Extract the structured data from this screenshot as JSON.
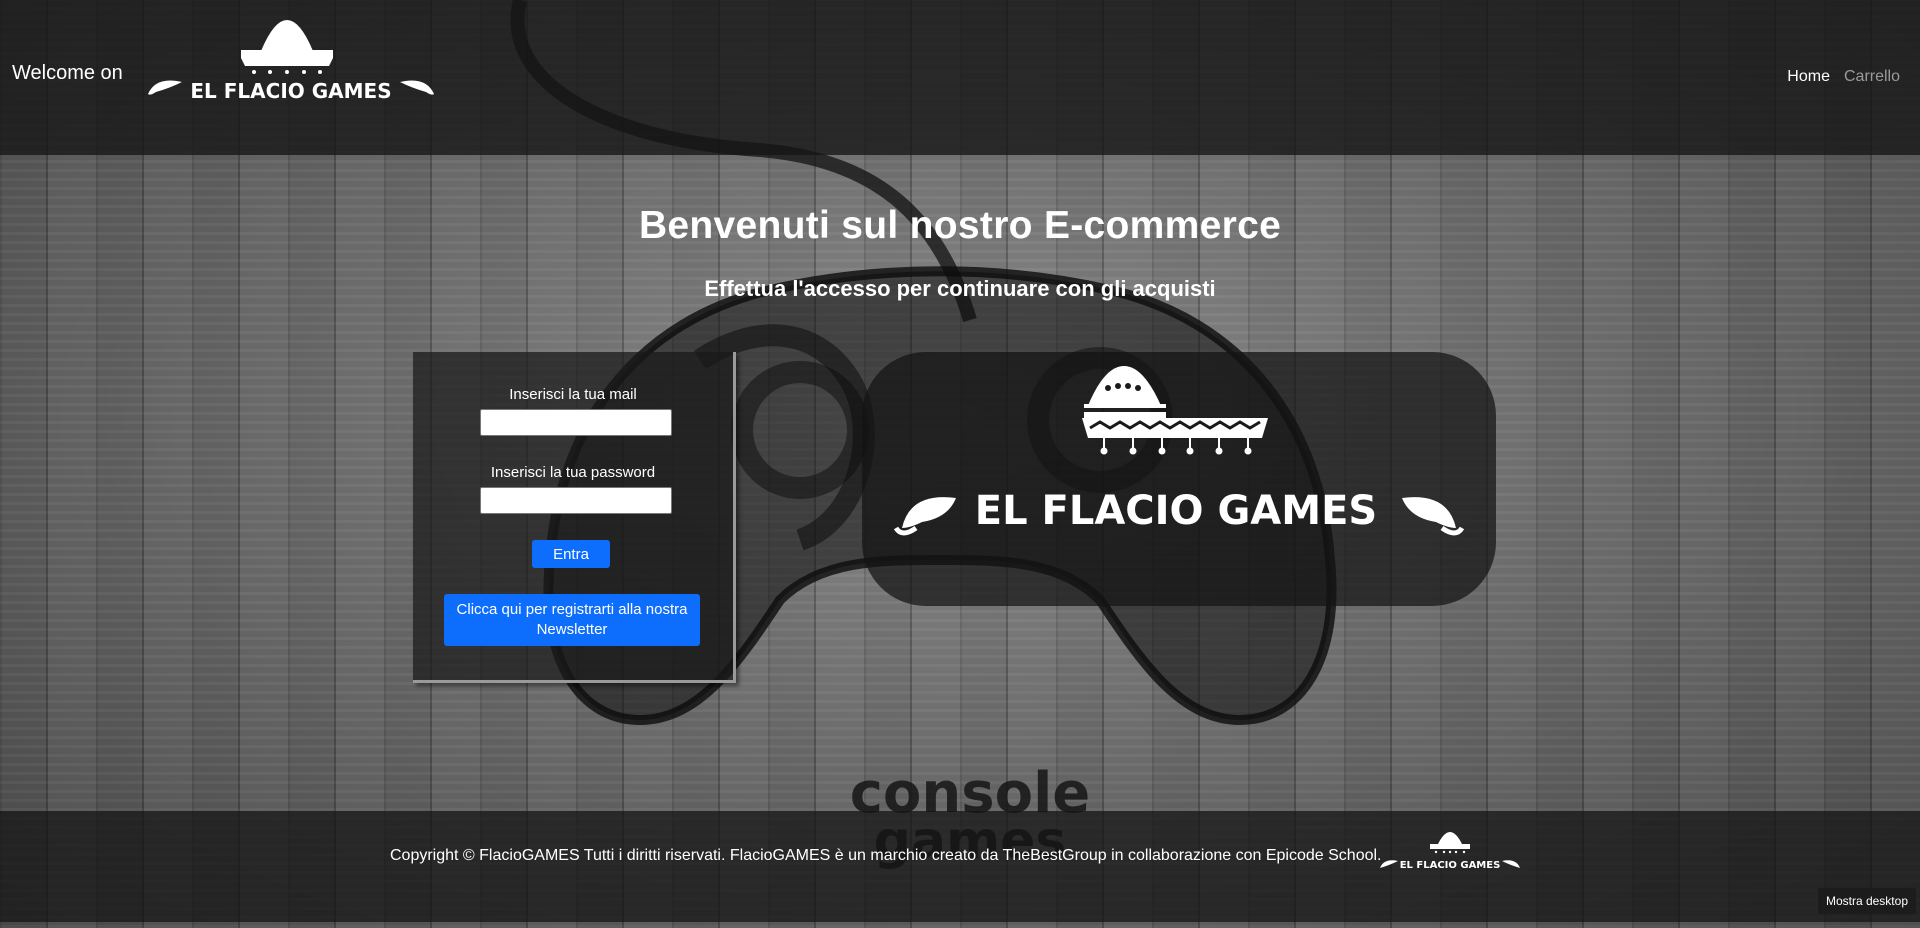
{
  "header": {
    "welcome": "Welcome on",
    "logo_text": "EL FLACIO GAMES",
    "nav": {
      "home": "Home",
      "cart": "Carrello"
    }
  },
  "main": {
    "title": "Benvenuti sul nostro E-commerce",
    "subtitle": "Effettua l'accesso per continuare con gli acquisti"
  },
  "login": {
    "email_label": "Inserisci la tua mail",
    "email_value": "",
    "password_label": "Inserisci la tua password",
    "password_value": "",
    "enter_button": "Entra",
    "newsletter_button": "Clicca qui per registrarti alla nostra Newsletter"
  },
  "logo_panel": {
    "logo_text": "EL FLACIO GAMES"
  },
  "background": {
    "art_text_line1": "console",
    "art_text_line2": "games"
  },
  "footer": {
    "copyright": "Copyright © FlacioGAMES Tutti i diritti riservati. FlacioGAMES è un marchio creato da TheBestGroup in collaborazione con Epicode School.",
    "logo_text": "EL FLACIO GAMES"
  },
  "taskbar": {
    "show_desktop": "Mostra desktop"
  },
  "colors": {
    "accent": "#0d6efd",
    "header_bg": "#141414",
    "nav_inactive": "#9a9a9a"
  }
}
